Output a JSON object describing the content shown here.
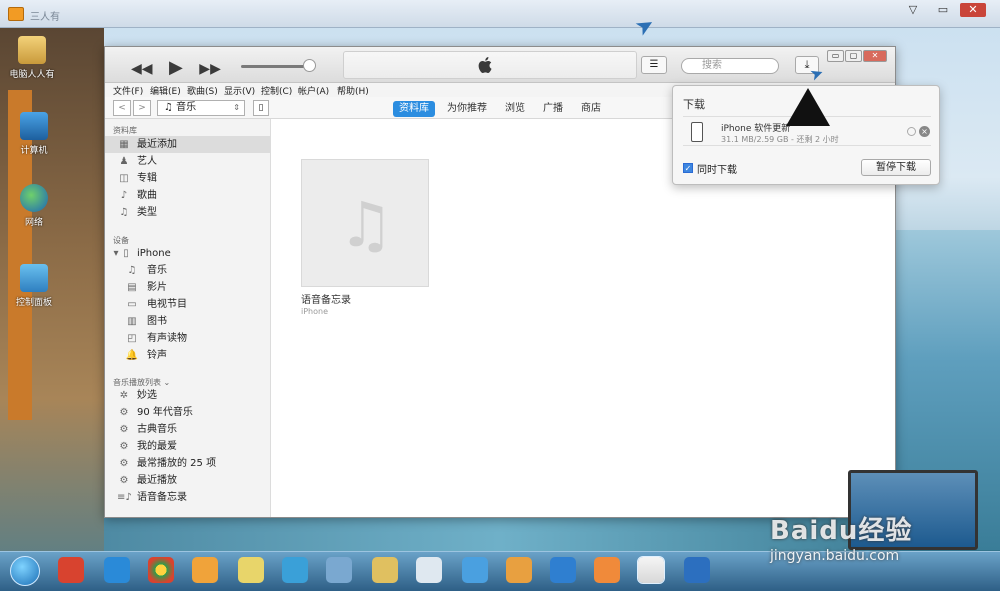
{
  "viewer": {
    "title": "三人有",
    "ctrl_min": "▽",
    "ctrl_max": "▭",
    "ctrl_close": "✕"
  },
  "desktop": {
    "icons": [
      {
        "label": "电脑人人有",
        "icon": "folder-person-icon"
      },
      {
        "label": "计算机",
        "icon": "computer-icon"
      },
      {
        "label": "网络",
        "icon": "network-globe-icon"
      },
      {
        "label": "控制面板",
        "icon": "control-panel-icon"
      }
    ]
  },
  "itunes": {
    "toolbar": {
      "rewind": "◀◀",
      "play": "▶",
      "forward": "▶▶",
      "list_view": "☰",
      "search_placeholder": "搜索",
      "search_icon": "⌕",
      "download": "⤓",
      "win_min": "▭",
      "win_max": "▢",
      "win_close": "✕"
    },
    "menu": [
      "文件(F)",
      "编辑(E)",
      "歌曲(S)",
      "显示(V)",
      "控制(C)",
      "帐户(A)",
      "帮助(H)"
    ],
    "nav": {
      "back": "<",
      "forward": ">",
      "media_type": "♫ 音乐",
      "device": "▯",
      "tabs": [
        {
          "label": "资料库",
          "active": true
        },
        {
          "label": "为你推荐",
          "active": false
        },
        {
          "label": "浏览",
          "active": false
        },
        {
          "label": "广播",
          "active": false
        },
        {
          "label": "商店",
          "active": false
        }
      ]
    },
    "sidebar": {
      "library_header": "资料库",
      "library": [
        {
          "label": "最近添加",
          "icon": "▦",
          "selected": true
        },
        {
          "label": "艺人",
          "icon": "♟"
        },
        {
          "label": "专辑",
          "icon": "◫"
        },
        {
          "label": "歌曲",
          "icon": "♪"
        },
        {
          "label": "类型",
          "icon": "♫"
        }
      ],
      "devices_header": "设备",
      "device_name": "iPhone",
      "device_items": [
        {
          "label": "音乐",
          "icon": "♫"
        },
        {
          "label": "影片",
          "icon": "▤"
        },
        {
          "label": "电视节目",
          "icon": "▭"
        },
        {
          "label": "图书",
          "icon": "▥"
        },
        {
          "label": "有声读物",
          "icon": "◰"
        },
        {
          "label": "铃声",
          "icon": "🔔"
        }
      ],
      "playlists_header": "音乐播放列表 ⌄",
      "playlists": [
        {
          "label": "妙选",
          "icon": "✲"
        },
        {
          "label": "90 年代音乐",
          "icon": "⚙"
        },
        {
          "label": "古典音乐",
          "icon": "⚙"
        },
        {
          "label": "我的最爱",
          "icon": "⚙"
        },
        {
          "label": "最常播放的 25 项",
          "icon": "⚙"
        },
        {
          "label": "最近播放",
          "icon": "⚙"
        },
        {
          "label": "语音备忘录",
          "icon": "≡♪"
        }
      ]
    },
    "content": {
      "album_title": "语音备忘录",
      "album_subtitle": "iPhone",
      "note_glyph": "♫"
    }
  },
  "downloads": {
    "title": "下载",
    "item_name": "iPhone 软件更新",
    "item_meta": "31.1 MB/2.59 GB - 还剩 2 小时",
    "cancel": "×",
    "concurrent_label": "同时下载",
    "concurrent_checked": "✓",
    "pause_button": "暂停下载"
  },
  "watermark": {
    "brand": "Baidu经验",
    "url": "jingyan.baidu.com"
  },
  "colors": {
    "accent": "#2b8de0",
    "selection": "#dcdcdc"
  }
}
